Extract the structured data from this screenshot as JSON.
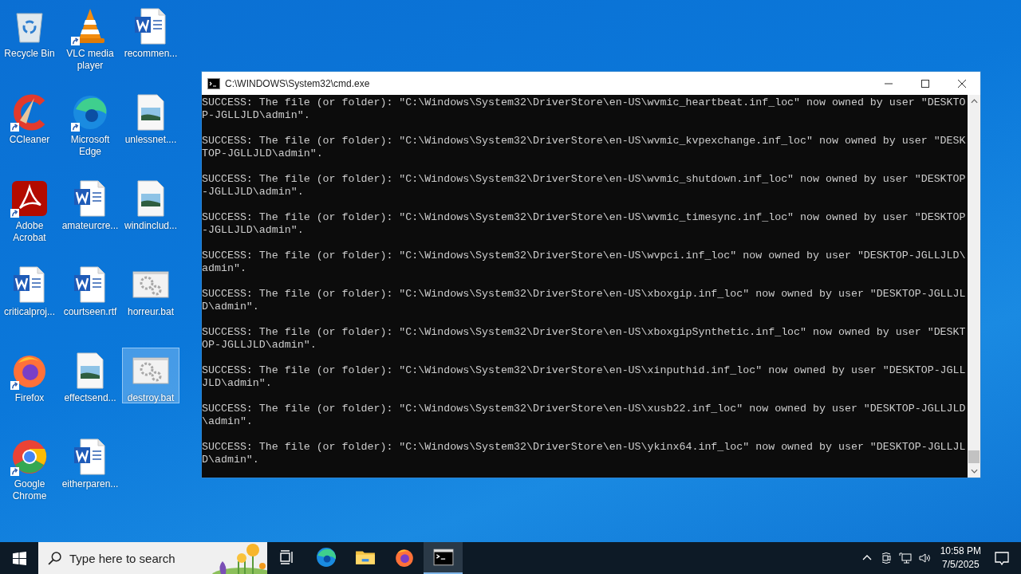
{
  "desktop_icons": [
    {
      "label": "Recycle Bin",
      "kind": "recycle",
      "shortcut": false,
      "selected": false
    },
    {
      "label": "CCleaner",
      "kind": "ccleaner",
      "shortcut": true,
      "selected": false
    },
    {
      "label": "Adobe Acrobat",
      "kind": "acrobat",
      "shortcut": true,
      "selected": false
    },
    {
      "label": "criticalproj...",
      "kind": "word",
      "shortcut": false,
      "selected": false
    },
    {
      "label": "Firefox",
      "kind": "firefox",
      "shortcut": true,
      "selected": false
    },
    {
      "label": "Google Chrome",
      "kind": "chrome",
      "shortcut": true,
      "selected": false
    },
    {
      "label": "VLC media player",
      "kind": "vlc",
      "shortcut": true,
      "selected": false
    },
    {
      "label": "Microsoft Edge",
      "kind": "edge",
      "shortcut": true,
      "selected": false
    },
    {
      "label": "amateurcre...",
      "kind": "word",
      "shortcut": false,
      "selected": false
    },
    {
      "label": "courtseen.rtf",
      "kind": "word",
      "shortcut": false,
      "selected": false
    },
    {
      "label": "effectsend...",
      "kind": "image",
      "shortcut": false,
      "selected": false
    },
    {
      "label": "eitherparen...",
      "kind": "word",
      "shortcut": false,
      "selected": false
    },
    {
      "label": "recommen...",
      "kind": "word",
      "shortcut": false,
      "selected": false
    },
    {
      "label": "unlessnet....",
      "kind": "image",
      "shortcut": false,
      "selected": false
    },
    {
      "label": "windinclud...",
      "kind": "image",
      "shortcut": false,
      "selected": false
    },
    {
      "label": "horreur.bat",
      "kind": "bat",
      "shortcut": false,
      "selected": false
    },
    {
      "label": "destroy.bat",
      "kind": "bat",
      "shortcut": false,
      "selected": true
    }
  ],
  "window": {
    "title": "C:\\WINDOWS\\System32\\cmd.exe",
    "output": [
      {
        "lines": [
          "SUCCESS: The file (or folder): \"C:\\Windows\\System32\\DriverStore\\en-US\\wvmic_heartbeat.inf_loc\" now owned by user \"DESKTO",
          "P-JGLLJLD\\admin\"."
        ]
      },
      {
        "lines": [
          "SUCCESS: The file (or folder): \"C:\\Windows\\System32\\DriverStore\\en-US\\wvmic_kvpexchange.inf_loc\" now owned by user \"DESK",
          "TOP-JGLLJLD\\admin\"."
        ]
      },
      {
        "lines": [
          "SUCCESS: The file (or folder): \"C:\\Windows\\System32\\DriverStore\\en-US\\wvmic_shutdown.inf_loc\" now owned by user \"DESKTOP",
          "-JGLLJLD\\admin\"."
        ]
      },
      {
        "lines": [
          "SUCCESS: The file (or folder): \"C:\\Windows\\System32\\DriverStore\\en-US\\wvmic_timesync.inf_loc\" now owned by user \"DESKTOP",
          "-JGLLJLD\\admin\"."
        ]
      },
      {
        "lines": [
          "SUCCESS: The file (or folder): \"C:\\Windows\\System32\\DriverStore\\en-US\\wvpci.inf_loc\" now owned by user \"DESKTOP-JGLLJLD\\",
          "admin\"."
        ]
      },
      {
        "lines": [
          "SUCCESS: The file (or folder): \"C:\\Windows\\System32\\DriverStore\\en-US\\xboxgip.inf_loc\" now owned by user \"DESKTOP-JGLLJL",
          "D\\admin\"."
        ]
      },
      {
        "lines": [
          "SUCCESS: The file (or folder): \"C:\\Windows\\System32\\DriverStore\\en-US\\xboxgipSynthetic.inf_loc\" now owned by user \"DESKT",
          "OP-JGLLJLD\\admin\"."
        ]
      },
      {
        "lines": [
          "SUCCESS: The file (or folder): \"C:\\Windows\\System32\\DriverStore\\en-US\\xinputhid.inf_loc\" now owned by user \"DESKTOP-JGLL",
          "JLD\\admin\"."
        ]
      },
      {
        "lines": [
          "SUCCESS: The file (or folder): \"C:\\Windows\\System32\\DriverStore\\en-US\\xusb22.inf_loc\" now owned by user \"DESKTOP-JGLLJLD",
          "\\admin\"."
        ]
      },
      {
        "lines": [
          "SUCCESS: The file (or folder): \"C:\\Windows\\System32\\DriverStore\\en-US\\ykinx64.inf_loc\" now owned by user \"DESKTOP-JGLLJL",
          "D\\admin\"."
        ]
      }
    ]
  },
  "taskbar": {
    "search": {
      "placeholder": "Type here to search"
    },
    "apps": [
      {
        "kind": "taskview",
        "active": false
      },
      {
        "kind": "edge",
        "active": false
      },
      {
        "kind": "explorer",
        "active": false
      },
      {
        "kind": "firefox",
        "active": false
      },
      {
        "kind": "cmd",
        "active": true
      }
    ],
    "time": "10:58 PM",
    "date": "7/5/2025"
  }
}
